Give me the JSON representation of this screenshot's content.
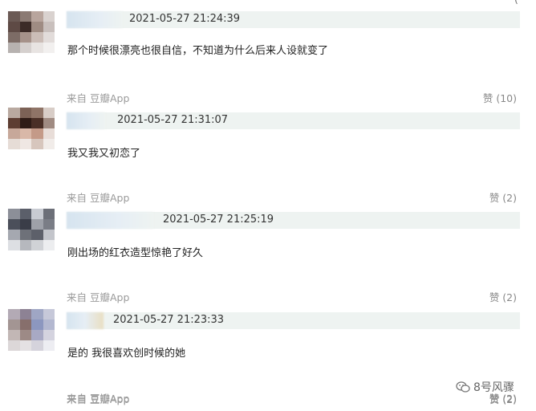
{
  "top_partial": "(",
  "comments": [
    {
      "timestamp": "2021-05-27 21:24:39",
      "text": "那个时候很漂亮也很自信，不知道为什么后来人设就变了",
      "source": "来自 豆瓣App",
      "likes": "赞 (10)",
      "avatar_colors": [
        "#6b5a55",
        "#8b7a73",
        "#b8a59d",
        "#d9d2cf",
        "#5e4a45",
        "#3c2b27",
        "#9f8c83",
        "#c9c0bd",
        "#7d6c66",
        "#a6928a",
        "#cbbdb7",
        "#e2dcda",
        "#b7b2b0",
        "#d5d0ce",
        "#e8e4e2",
        "#f2f0ef"
      ]
    },
    {
      "timestamp": "2021-05-27 21:31:07",
      "text": "我又我又初恋了",
      "source": "来自 豆瓣App",
      "likes": "赞 (2)",
      "avatar_colors": [
        "#b9a9a0",
        "#7c6256",
        "#8f7467",
        "#d8cdc7",
        "#5d3d32",
        "#2f1c16",
        "#4a2f26",
        "#a08b82",
        "#c7a89a",
        "#d9b8a8",
        "#c49a88",
        "#e8ddd8",
        "#e6dcd6",
        "#efe7e3",
        "#d7c6bd",
        "#f1ece9"
      ]
    },
    {
      "timestamp": "2021-05-27 21:25:19",
      "text": "刚出场的红衣造型惊艳了好久",
      "source": "来自 豆瓣App",
      "likes": "赞 (2)",
      "avatar_colors": [
        "#8c8f98",
        "#5b5f6a",
        "#c8cbd2",
        "#6c6f78",
        "#4b4f5a",
        "#3a3d48",
        "#9ea1a9",
        "#7a7d86",
        "#a5a8b0",
        "#6e7179",
        "#5d606a",
        "#c3c5cb",
        "#dddfe3",
        "#b6b8be",
        "#d0d2d6",
        "#ecedef"
      ]
    },
    {
      "timestamp": "2021-05-27 21:23:33",
      "text": "是的 我很喜欢创时候的她",
      "source": "来自 豆瓣App",
      "likes": "赞 (2)",
      "avatar_colors": [
        "#b3aab5",
        "#8d8294",
        "#9fa6c4",
        "#c6c8d9",
        "#a39593",
        "#876f6c",
        "#8c97bf",
        "#b3b8d0",
        "#c2b7b5",
        "#9d8a86",
        "#a8a9c4",
        "#d4d3df",
        "#dcd7d8",
        "#e4e1e3",
        "#d5d3dc",
        "#ededf2"
      ]
    },
    {
      "source": "来自 豆瓣App",
      "likes": "赞 (2)"
    }
  ],
  "watermark": "8号风骤",
  "colors": {
    "name_bar": "#eef3f1",
    "source_text": "#9a9a9a",
    "likes_text": "#888888"
  }
}
